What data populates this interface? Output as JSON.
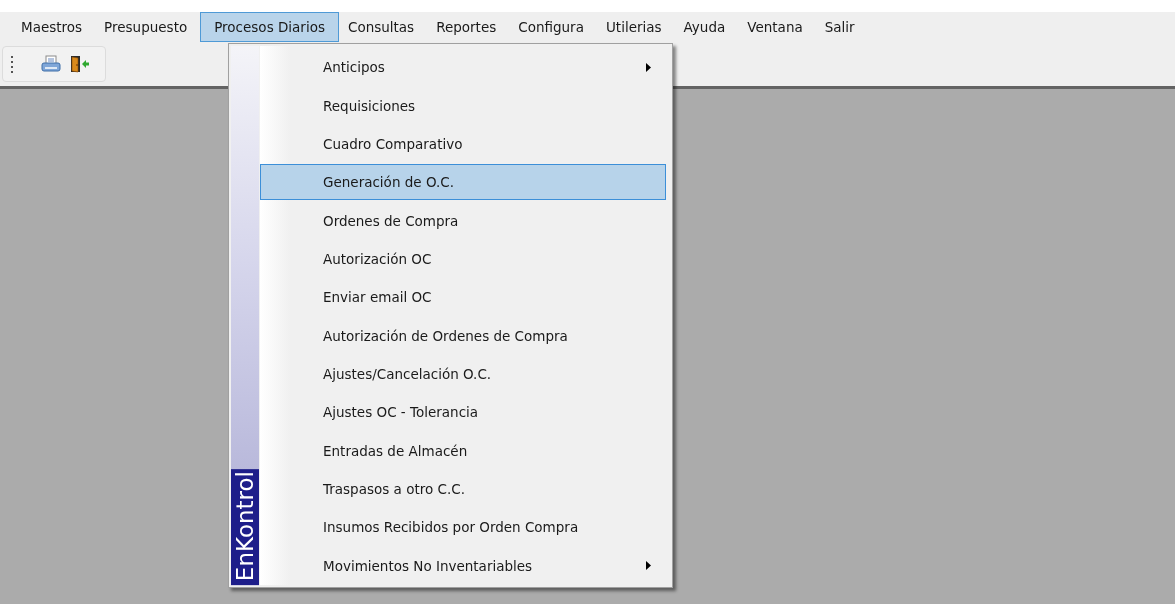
{
  "menu_bar": [
    {
      "label": "Maestros",
      "selected": false
    },
    {
      "label": "Presupuesto",
      "selected": false
    },
    {
      "label": "Procesos Diarios",
      "selected": true
    },
    {
      "label": "Consultas",
      "selected": false
    },
    {
      "label": "Reportes",
      "selected": false
    },
    {
      "label": "Configura",
      "selected": false
    },
    {
      "label": "Utilerias",
      "selected": false
    },
    {
      "label": "Ayuda",
      "selected": false
    },
    {
      "label": "Ventana",
      "selected": false
    },
    {
      "label": "Salir",
      "selected": false
    }
  ],
  "toolbar": [
    {
      "kind": "print"
    },
    {
      "kind": "exit"
    }
  ],
  "dropdown": {
    "side_label": "EnKontrol",
    "items": [
      {
        "label": "Anticipos",
        "submenu": true,
        "selected": false
      },
      {
        "label": "Requisiciones",
        "submenu": false,
        "selected": false
      },
      {
        "label": "Cuadro Comparativo",
        "submenu": false,
        "selected": false
      },
      {
        "label": "Generación de O.C.",
        "submenu": false,
        "selected": true
      },
      {
        "label": "Ordenes de Compra",
        "submenu": false,
        "selected": false
      },
      {
        "label": "Autorización OC",
        "submenu": false,
        "selected": false
      },
      {
        "label": "Enviar email OC",
        "submenu": false,
        "selected": false
      },
      {
        "label": "Autorización de Ordenes de Compra",
        "submenu": false,
        "selected": false
      },
      {
        "label": "Ajustes/Cancelación O.C.",
        "submenu": false,
        "selected": false
      },
      {
        "label": "Ajustes OC - Tolerancia",
        "submenu": false,
        "selected": false
      },
      {
        "label": "Entradas de Almacén",
        "submenu": false,
        "selected": false
      },
      {
        "label": "Traspasos a otro C.C.",
        "submenu": false,
        "selected": false
      },
      {
        "label": "Insumos Recibidos por Orden Compra",
        "submenu": false,
        "selected": false
      },
      {
        "label": "Movimientos No Inventariables",
        "submenu": true,
        "selected": false
      }
    ]
  }
}
